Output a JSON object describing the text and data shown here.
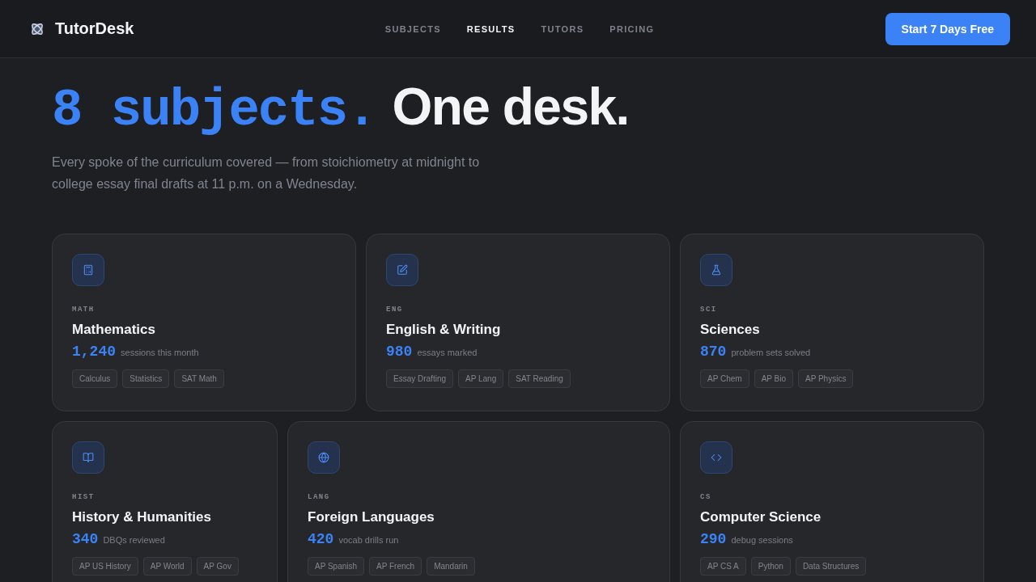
{
  "brand": {
    "name": "TutorDesk"
  },
  "nav": [
    {
      "label": "SUBJECTS",
      "selected": false
    },
    {
      "label": "RESULTS",
      "selected": true
    },
    {
      "label": "TUTORS",
      "selected": false
    },
    {
      "label": "PRICING",
      "selected": false
    }
  ],
  "cta": "Start 7 Days Free",
  "hero": {
    "headline_accent": "8 subjects.",
    "headline": "One desk.",
    "lead": "Every spoke of the curriculum covered — from stoichiometry at midnight to college essay final drafts at 11 p.m. on a Wednesday."
  },
  "subjects": [
    {
      "code": "MATH",
      "title": "Mathematics",
      "count": "1,240",
      "unit": "sessions this month",
      "tags": [
        "Calculus",
        "Statistics",
        "SAT Math"
      ]
    },
    {
      "code": "ENG",
      "title": "English & Writing",
      "count": "980",
      "unit": "essays marked",
      "tags": [
        "Essay Drafting",
        "AP Lang",
        "SAT Reading"
      ]
    },
    {
      "code": "SCI",
      "title": "Sciences",
      "count": "870",
      "unit": "problem sets solved",
      "tags": [
        "AP Chem",
        "AP Bio",
        "AP Physics"
      ]
    },
    {
      "code": "HIST",
      "title": "History & Humanities",
      "count": "340",
      "unit": "DBQs reviewed",
      "tags": [
        "AP US History",
        "AP World",
        "AP Gov"
      ]
    },
    {
      "code": "LANG",
      "title": "Foreign Languages",
      "count": "420",
      "unit": "vocab drills run",
      "tags": [
        "AP Spanish",
        "AP French",
        "Mandarin"
      ]
    },
    {
      "code": "CS",
      "title": "Computer Science",
      "count": "290",
      "unit": "debug sessions",
      "tags": [
        "AP CS A",
        "Python",
        "Data Structures"
      ]
    }
  ]
}
